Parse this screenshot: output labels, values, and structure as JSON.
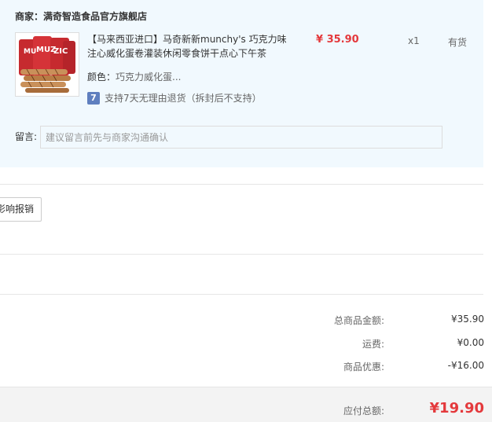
{
  "shop": {
    "label": "商家：",
    "name": "满奇智造食品官方旗舰店"
  },
  "product": {
    "title": "【马来西亚进口】马奇新新munchy's 巧克力味注心威化蛋卷灌装休闲零食饼干点心下午茶",
    "price": "¥ 35.90",
    "quantity": "x1",
    "stock": "有货",
    "spec_label": "颜色：",
    "spec_value": "巧克力威化蛋...",
    "return_icon": "7",
    "return_policy": "支持7天无理由退货（拆封后不支持）",
    "image_icon": "munchys-wafer-roll-product-image"
  },
  "remark": {
    "label": "留言:",
    "placeholder": "建议留言前先与商家沟通确认"
  },
  "invoice": {
    "button_label": "影响报销"
  },
  "summary": {
    "rows": [
      {
        "label": "总商品金额:",
        "value": "¥35.90"
      },
      {
        "label": "运费:",
        "value": "¥0.00"
      },
      {
        "label": "商品优惠:",
        "value": "-¥16.00"
      }
    ],
    "total_label": "应付总额:",
    "total_value": "¥19.90"
  },
  "colors": {
    "card_bg": "#f1f9fe",
    "price_red": "#e4393c",
    "return_icon_blue": "#5f7fbf"
  }
}
